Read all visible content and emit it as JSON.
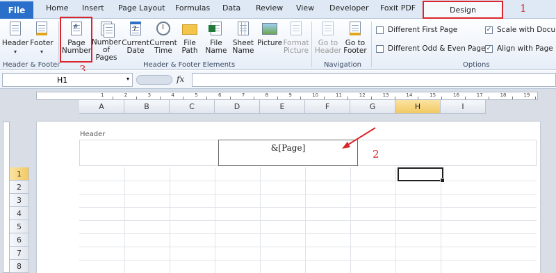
{
  "tabs": {
    "file": "File",
    "home": "Home",
    "insert": "Insert",
    "page_layout": "Page Layout",
    "formulas": "Formulas",
    "data": "Data",
    "review": "Review",
    "view": "View",
    "developer": "Developer",
    "foxit": "Foxit PDF",
    "design": "Design"
  },
  "ribbon": {
    "header": "Header",
    "footer": "Footer",
    "page_number": "Page\nNumber",
    "number_of_pages": "Number\nof Pages",
    "current_date": "Current\nDate",
    "current_time": "Current\nTime",
    "file_path": "File\nPath",
    "file_name": "File\nName",
    "sheet_name": "Sheet\nName",
    "picture": "Picture",
    "format_picture": "Format\nPicture",
    "go_to_header": "Go to\nHeader",
    "go_to_footer": "Go to\nFooter",
    "group_header_footer": "Header & Footer",
    "group_elements": "Header & Footer Elements",
    "group_navigation": "Navigation",
    "group_options": "Options",
    "opt_different_first_page": "Different First Page",
    "opt_different_odd_even": "Different Odd & Even Pages",
    "opt_scale_with_document": "Scale with Docume",
    "opt_align_with_margins": "Align with Page M"
  },
  "options_checked": {
    "different_first_page": false,
    "different_odd_even": false,
    "scale_with_document": true,
    "align_with_margins": true
  },
  "formula_bar": {
    "name_box": "H1",
    "fx": "fx",
    "value": ""
  },
  "sheet": {
    "columns": [
      "A",
      "B",
      "C",
      "D",
      "E",
      "F",
      "G",
      "H",
      "I"
    ],
    "selected_column": "H",
    "rows": [
      "1",
      "2",
      "3",
      "4",
      "5",
      "6",
      "7",
      "8"
    ],
    "selected_row": "1",
    "header_label": "Header",
    "header_center_text": "&[Page]",
    "ruler_numbers": [
      "1",
      "2",
      "3",
      "4",
      "5",
      "6",
      "7",
      "8",
      "9",
      "10",
      "11",
      "12",
      "13",
      "14",
      "15",
      "16",
      "17",
      "18",
      "19"
    ]
  },
  "annotations": {
    "step1": "1",
    "step2": "2",
    "step3": "3",
    "color": "#d9262b"
  }
}
